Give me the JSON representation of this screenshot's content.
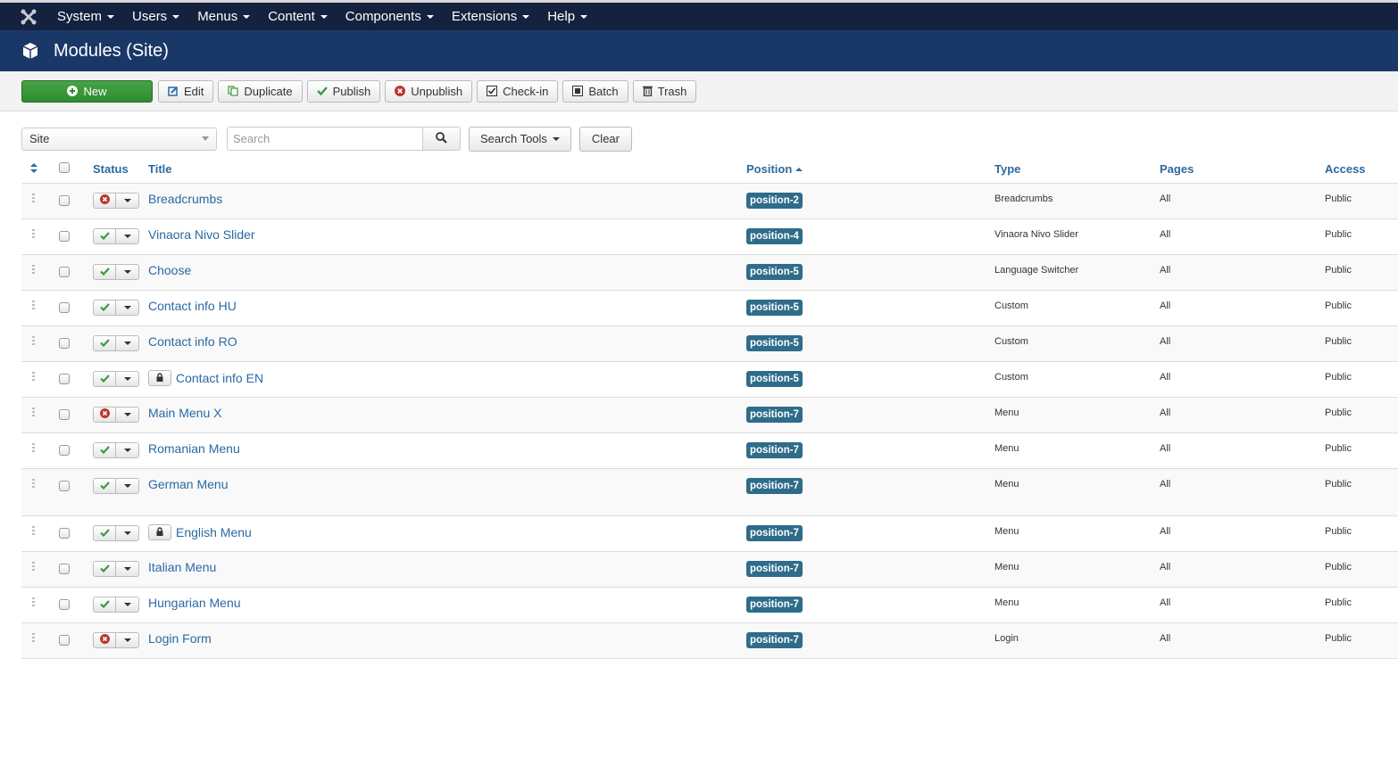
{
  "navbar": {
    "logo_icon": "joomla-logo-icon",
    "items": [
      {
        "label": "System"
      },
      {
        "label": "Users"
      },
      {
        "label": "Menus"
      },
      {
        "label": "Content"
      },
      {
        "label": "Components"
      },
      {
        "label": "Extensions"
      },
      {
        "label": "Help"
      }
    ]
  },
  "header": {
    "icon": "cube-icon",
    "title": "Modules (Site)"
  },
  "toolbar": {
    "new_label": "New",
    "edit_label": "Edit",
    "duplicate_label": "Duplicate",
    "publish_label": "Publish",
    "unpublish_label": "Unpublish",
    "checkin_label": "Check-in",
    "batch_label": "Batch",
    "trash_label": "Trash"
  },
  "filters": {
    "client_select_value": "Site",
    "search_placeholder": "Search",
    "search_value": "",
    "search_tools_label": "Search Tools",
    "clear_label": "Clear"
  },
  "table": {
    "headers": {
      "status": "Status",
      "title": "Title",
      "position": "Position",
      "type": "Type",
      "pages": "Pages",
      "access": "Access"
    },
    "sort": {
      "column": "Position",
      "direction": "ascending"
    },
    "colors": {
      "published": "#3c9a3c",
      "unpublished": "#bd362f",
      "position_badge": "#2e6c8a",
      "link": "#2a69a4"
    },
    "rows": [
      {
        "title": "Breadcrumbs",
        "published": false,
        "locked": false,
        "position": "position-2",
        "type": "Breadcrumbs",
        "pages": "All",
        "access": "Public"
      },
      {
        "title": "Vinaora Nivo Slider",
        "published": true,
        "locked": false,
        "position": "position-4",
        "type": "Vinaora Nivo Slider",
        "pages": "All",
        "access": "Public"
      },
      {
        "title": "Choose",
        "published": true,
        "locked": false,
        "position": "position-5",
        "type": "Language Switcher",
        "pages": "All",
        "access": "Public"
      },
      {
        "title": "Contact info HU",
        "published": true,
        "locked": false,
        "position": "position-5",
        "type": "Custom",
        "pages": "All",
        "access": "Public"
      },
      {
        "title": "Contact info RO",
        "published": true,
        "locked": false,
        "position": "position-5",
        "type": "Custom",
        "pages": "All",
        "access": "Public"
      },
      {
        "title": "Contact info EN",
        "published": true,
        "locked": true,
        "position": "position-5",
        "type": "Custom",
        "pages": "All",
        "access": "Public"
      },
      {
        "title": "Main Menu X",
        "published": false,
        "locked": false,
        "position": "position-7",
        "type": "Menu",
        "pages": "All",
        "access": "Public"
      },
      {
        "title": "Romanian Menu",
        "published": true,
        "locked": false,
        "position": "position-7",
        "type": "Menu",
        "pages": "All",
        "access": "Public"
      },
      {
        "title": "German Menu",
        "published": true,
        "locked": false,
        "position": "position-7",
        "type": "Menu",
        "pages": "All",
        "access": "Public"
      },
      {
        "title": "English Menu",
        "published": true,
        "locked": true,
        "position": "position-7",
        "type": "Menu",
        "pages": "All",
        "access": "Public"
      },
      {
        "title": "Italian Menu",
        "published": true,
        "locked": false,
        "position": "position-7",
        "type": "Menu",
        "pages": "All",
        "access": "Public"
      },
      {
        "title": "Hungarian Menu",
        "published": true,
        "locked": false,
        "position": "position-7",
        "type": "Menu",
        "pages": "All",
        "access": "Public"
      },
      {
        "title": "Login Form",
        "published": false,
        "locked": false,
        "position": "position-7",
        "type": "Login",
        "pages": "All",
        "access": "Public"
      }
    ]
  }
}
